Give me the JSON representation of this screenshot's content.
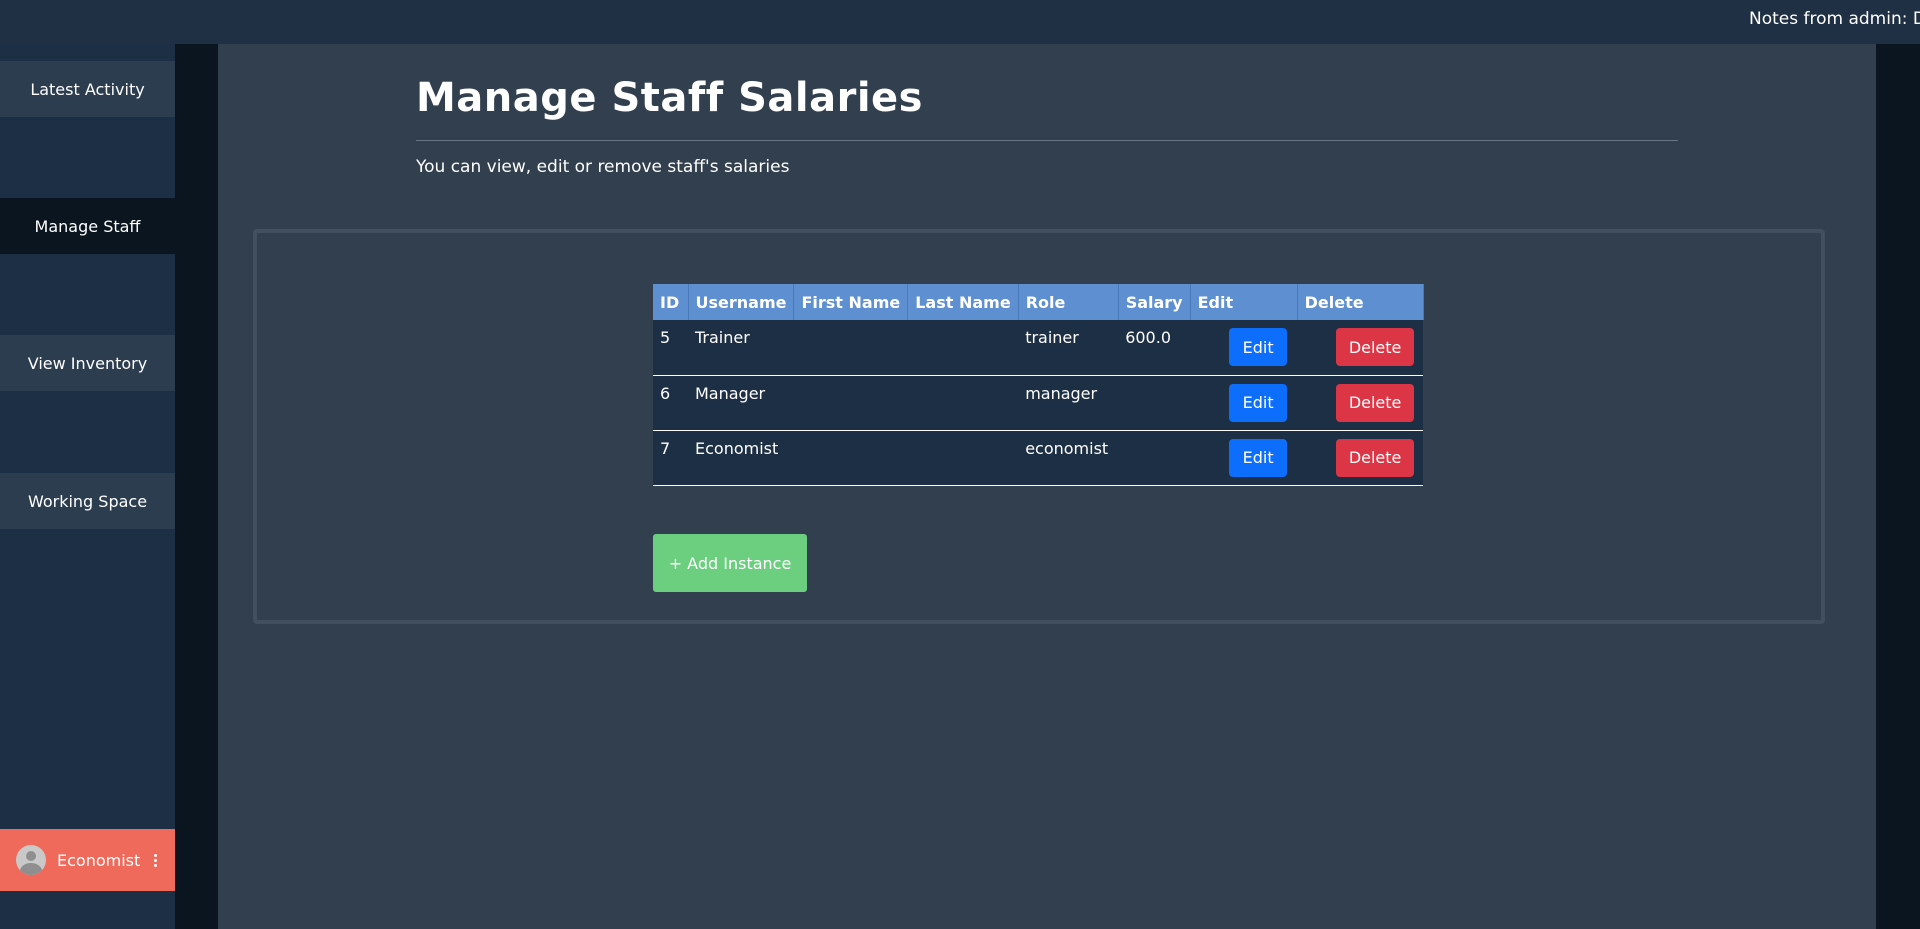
{
  "topbar": {
    "notes_text": "Notes from admin: Do"
  },
  "sidebar": {
    "items": [
      {
        "label": "Latest Activity"
      },
      {
        "label": "Manage Staff"
      },
      {
        "label": "View Inventory"
      },
      {
        "label": "Working Space"
      }
    ],
    "user": {
      "name": "Economist"
    }
  },
  "main": {
    "title": "Manage Staff Salaries",
    "subtitle": "You can view, edit or remove staff's salaries",
    "table": {
      "headers": [
        "ID",
        "Username",
        "First Name",
        "Last Name",
        "Role",
        "Salary",
        "Edit",
        "Delete"
      ],
      "rows": [
        {
          "id": "5",
          "username": "Trainer",
          "first_name": "",
          "last_name": "",
          "role": "trainer",
          "salary": "600.0"
        },
        {
          "id": "6",
          "username": "Manager",
          "first_name": "",
          "last_name": "",
          "role": "manager",
          "salary": ""
        },
        {
          "id": "7",
          "username": "Economist",
          "first_name": "",
          "last_name": "",
          "role": "economist",
          "salary": ""
        }
      ],
      "edit_label": "Edit",
      "delete_label": "Delete"
    },
    "add_button_label": "+ Add Instance"
  },
  "colors": {
    "sidebar_bg": "#1d2f44",
    "main_bg": "#323f4e",
    "header_blue": "#5e8fd0",
    "edit_blue": "#0d6efd",
    "delete_red": "#dc3545",
    "add_green": "#6bcf7f",
    "user_coral": "#ef6a5b"
  },
  "icons": {
    "avatar": "user-avatar-icon",
    "menu": "kebab-menu-icon"
  }
}
